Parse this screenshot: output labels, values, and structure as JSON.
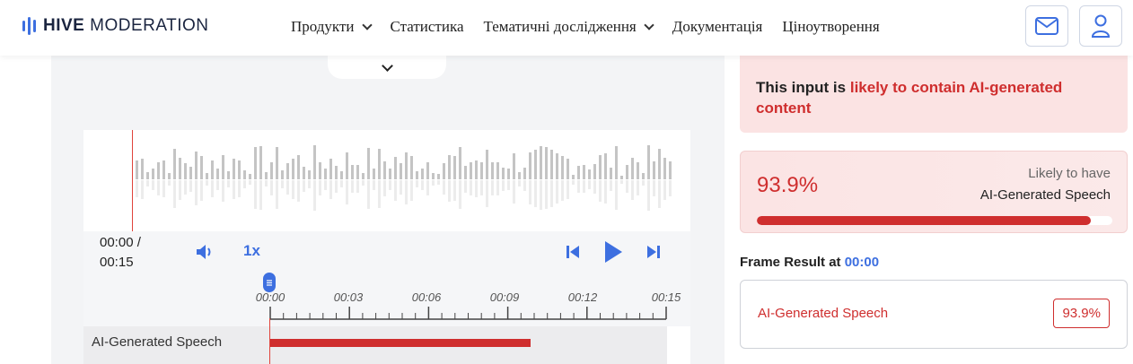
{
  "brand": {
    "bold": "HIVE",
    "rest": " MODERATION",
    "accent": "#3d6fe0"
  },
  "nav": {
    "items": [
      {
        "label": "Продукти",
        "dropdown": true
      },
      {
        "label": "Статистика",
        "dropdown": false
      },
      {
        "label": "Тематичні дослідження",
        "dropdown": true
      },
      {
        "label": "Документація",
        "dropdown": false
      },
      {
        "label": "Ціноутворення",
        "dropdown": false
      }
    ],
    "icons": [
      "mail-icon",
      "user-icon"
    ]
  },
  "player": {
    "time_current": "00:00 /",
    "time_total": "00:15",
    "speed": "1x",
    "ticks": [
      "00:00",
      "00:03",
      "00:06",
      "00:09",
      "00:12",
      "00:15"
    ],
    "track_label": "AI-Generated Speech",
    "track_fraction": 0.66
  },
  "result": {
    "alert_prefix": "This input is ",
    "alert_highlight": "likely to contain AI-generated content",
    "score": "93.9%",
    "score_fraction": 0.939,
    "score_sub": "Likely to have",
    "score_name": "AI-Generated Speech",
    "frame_title": "Frame Result at ",
    "frame_time": "00:00",
    "frame_label": "AI-Generated Speech",
    "frame_value": "93.9%",
    "danger_color": "#cf2e2e"
  }
}
